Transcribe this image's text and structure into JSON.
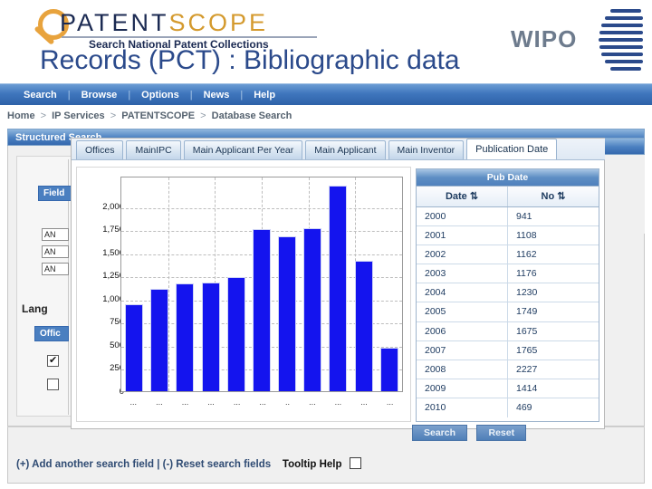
{
  "brand": {
    "patent_text": "PATENT",
    "scope_text": "SCOPE",
    "tagline": "Search National Patent Collections",
    "wipo_text": "WIPO"
  },
  "title_overlay": "Records (PCT) : Bibliographic data",
  "navbar": {
    "items": [
      "Search",
      "Browse",
      "Options",
      "News",
      "Help"
    ],
    "separator": "|"
  },
  "breadcrumb": {
    "items": [
      "Home",
      "IP Services",
      "PATENTSCOPE",
      "Database Search"
    ],
    "separator": ">"
  },
  "search_panel": {
    "header": "Structured Search",
    "field_label": "Field",
    "operators": [
      "AN",
      "AN",
      "AN"
    ],
    "language_label": "Lang",
    "office_label": "Offic",
    "checkbox_1_checked": true,
    "checkbox_2_checked": false,
    "footer": {
      "add_field": "(+) Add another search field",
      "divider": "|",
      "reset_fields": "(-) Reset search fields",
      "tooltip_help": "Tooltip Help"
    }
  },
  "chart_window": {
    "tabs": [
      {
        "label": "Offices",
        "active": false
      },
      {
        "label": "MainIPC",
        "active": false
      },
      {
        "label": "Main Applicant Per Year",
        "active": false
      },
      {
        "label": "Main Applicant",
        "active": false
      },
      {
        "label": "Main Inventor",
        "active": false
      },
      {
        "label": "Publication Date",
        "active": true
      }
    ],
    "table": {
      "title": "Pub Date",
      "columns": [
        "Date",
        "No"
      ],
      "sort_glyph": "⇅"
    },
    "actions": {
      "search": "Search",
      "reset": "Reset"
    }
  },
  "chart_data": {
    "type": "bar",
    "title": "Pub Date",
    "xlabel": "",
    "ylabel": "",
    "categories": [
      "2000",
      "2001",
      "2002",
      "2003",
      "2004",
      "2005",
      "2006",
      "2007",
      "2008",
      "2009",
      "2010"
    ],
    "x_tick_labels": [
      "...",
      "...",
      "...",
      "...",
      "...",
      "...",
      "..",
      "...",
      "...",
      "...",
      "..."
    ],
    "values": [
      941,
      1108,
      1162,
      1176,
      1230,
      1749,
      1675,
      1765,
      2227,
      1414,
      469
    ],
    "y_ticks": [
      0,
      250,
      500,
      750,
      1000,
      1250,
      1500,
      1750,
      2000
    ],
    "y_tick_labels": [
      "0",
      "250",
      "500",
      "750",
      "1,000",
      "1,250",
      "1,500",
      "1,750",
      "2,000"
    ],
    "ylim": [
      0,
      2330
    ],
    "grid": true,
    "legend": "none",
    "bar_color": "#1414ee"
  },
  "colors": {
    "nav_blue": "#3568ae",
    "accent_orange": "#D49A2E",
    "brand_navy": "#1b2a52",
    "bar_blue": "#1414ee",
    "table_header_blue": "#4f81bd"
  }
}
